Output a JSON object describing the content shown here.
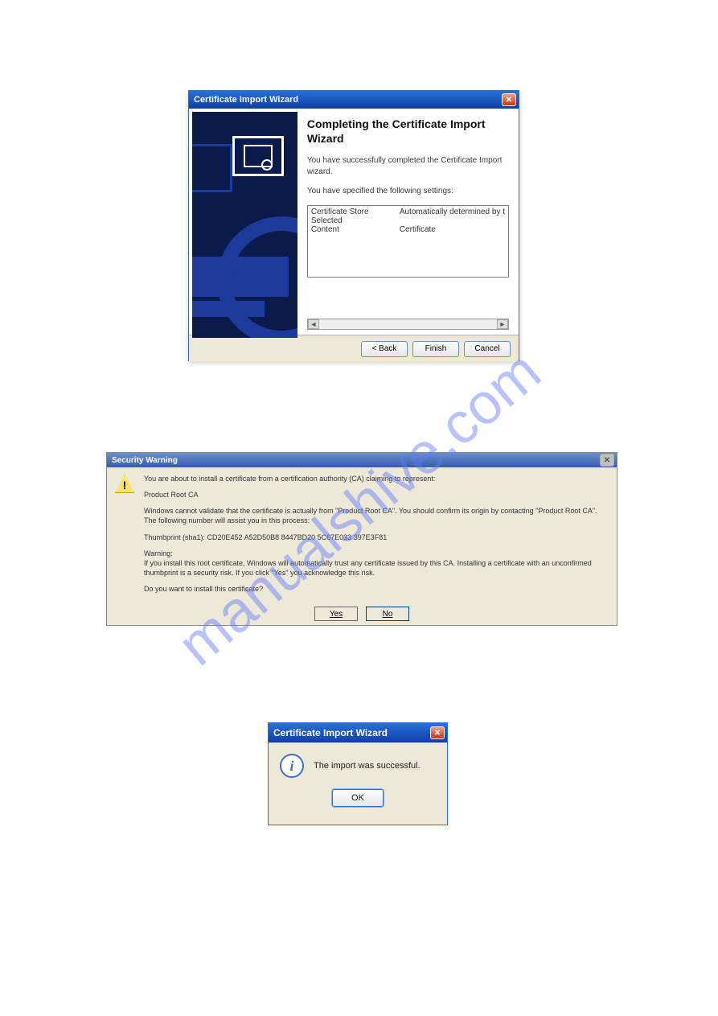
{
  "watermark": "manualshive.com",
  "wizard": {
    "title": "Certificate Import Wizard",
    "heading": "Completing the Certificate Import Wizard",
    "body1": "You have successfully completed the Certificate Import wizard.",
    "body2": "You have specified the following settings:",
    "settings": [
      {
        "label": "Certificate Store Selected",
        "value": "Automatically determined by t"
      },
      {
        "label": "Content",
        "value": "Certificate"
      }
    ],
    "scroll_left": "◄",
    "scroll_right": "►",
    "back_label": "< Back",
    "finish_label": "Finish",
    "cancel_label": "Cancel",
    "close_label": "✕"
  },
  "warning": {
    "title": "Security Warning",
    "close_label": "✕",
    "p1": "You are about to install a certificate from a certification authority (CA) claiming to represent:",
    "p2": "Product Root CA",
    "p3": "Windows cannot validate that the certificate is actually from \"Product Root CA\". You should confirm its origin by contacting \"Product Root CA\". The following number will assist you in this process:",
    "p4": "Thumbprint (sha1): CD20E452 A52D50B8 8447BD20 5C67E033 397E3F81",
    "p5": "Warning:",
    "p6": "If you install this root certificate, Windows will automatically trust any certificate issued by this CA. Installing a certificate with an unconfirmed thumbprint is a security risk. If you click \"Yes\" you acknowledge this risk.",
    "p7": "Do you want to install this certificate?",
    "yes_label": "Yes",
    "no_label": "No"
  },
  "success": {
    "title": "Certificate Import Wizard",
    "close_label": "✕",
    "text": "The import was successful.",
    "ok_label": "OK"
  }
}
